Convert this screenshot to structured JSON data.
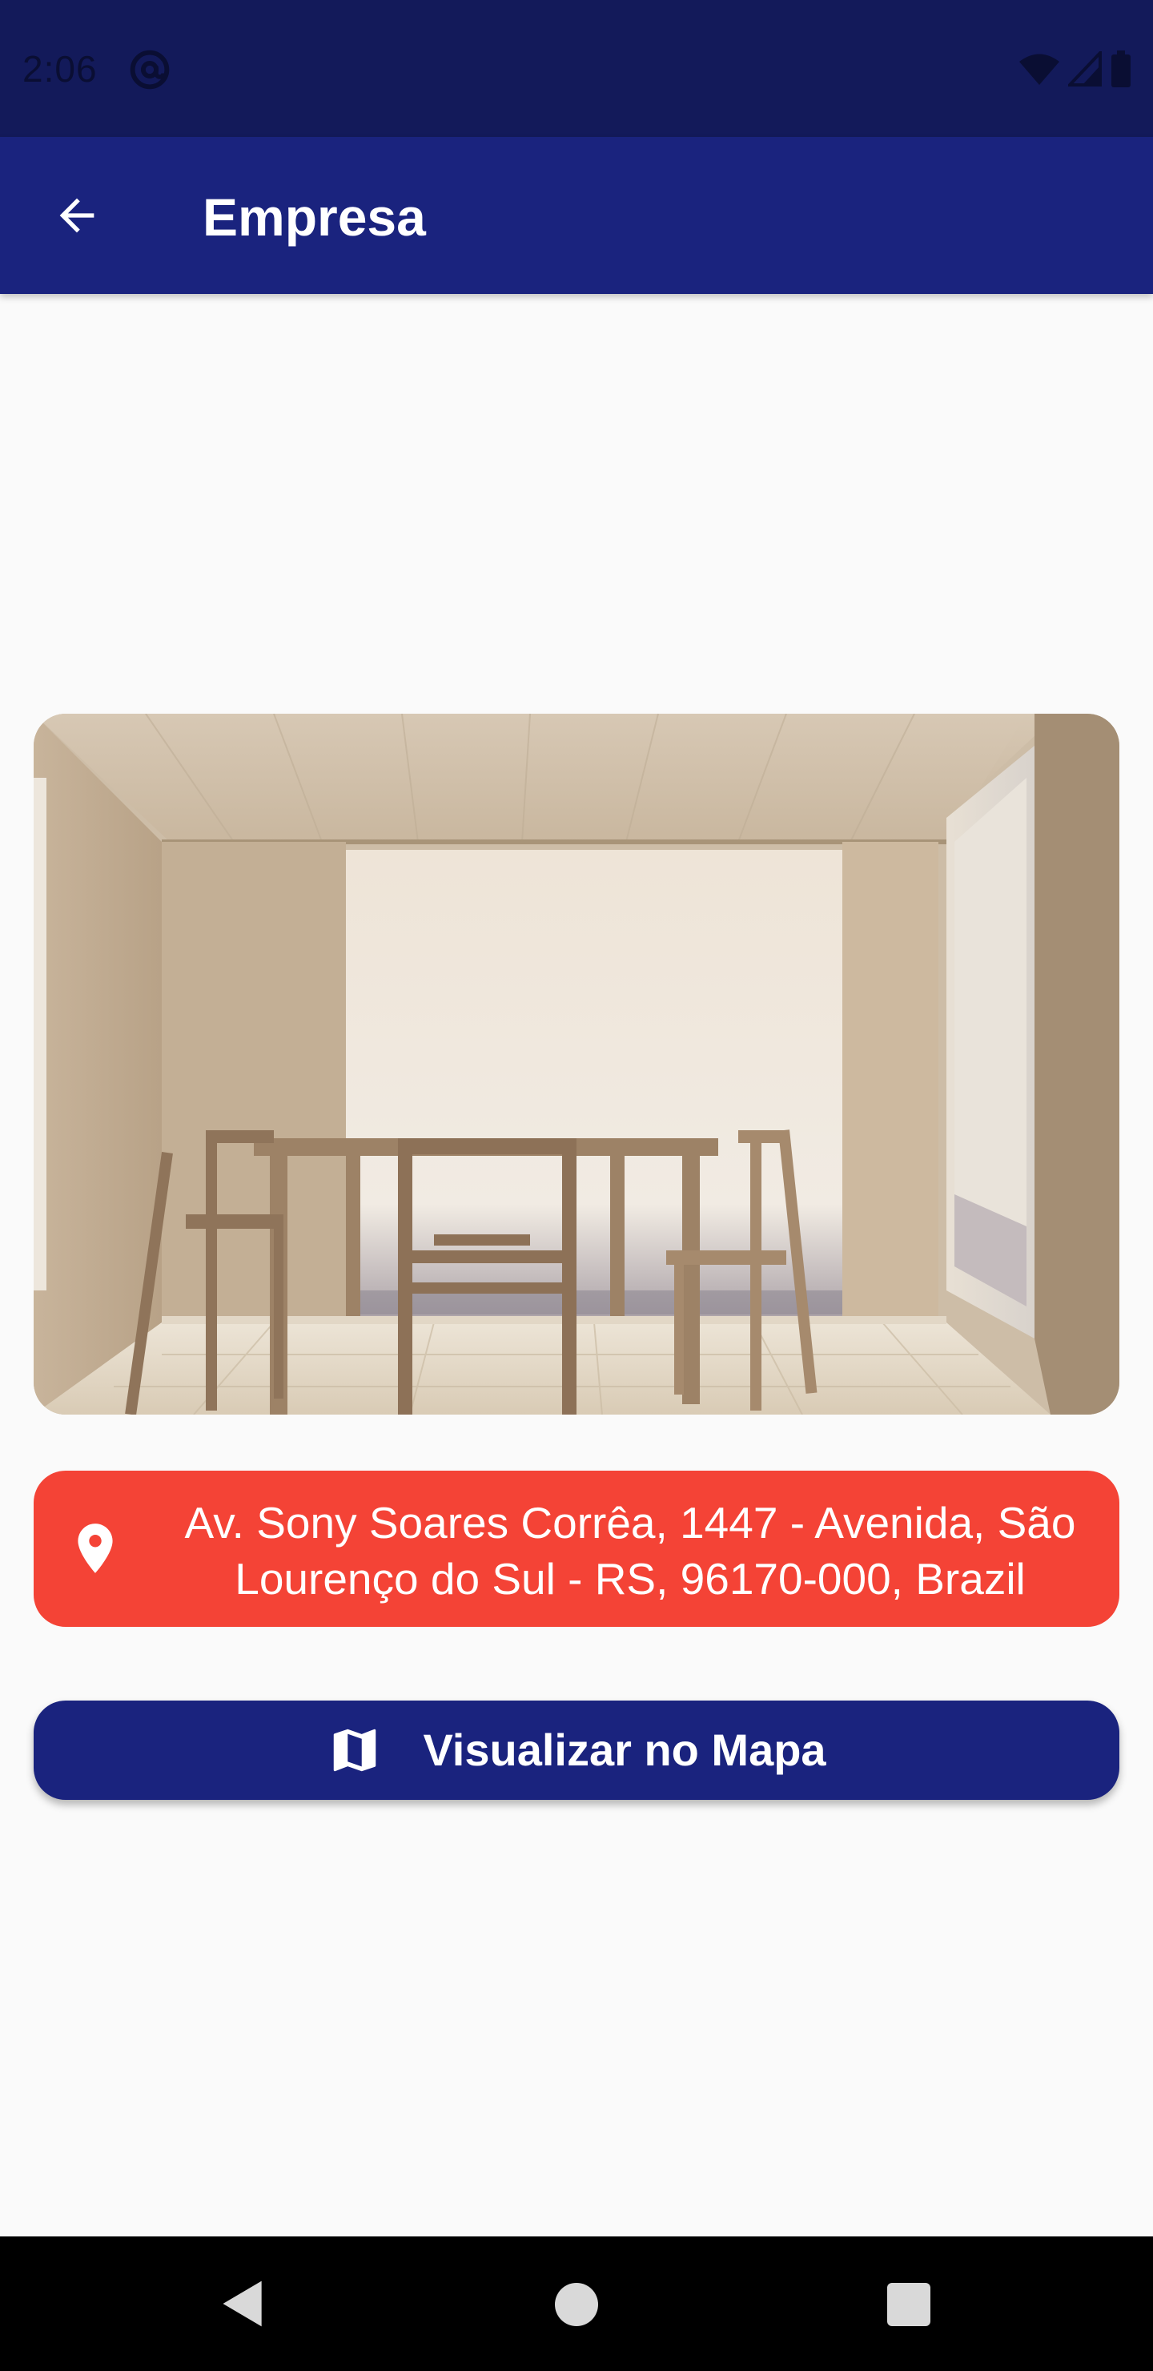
{
  "status_bar": {
    "time": "2:06",
    "icons": [
      "at-sign-icon",
      "wifi-icon",
      "cellular-signal-icon",
      "battery-icon"
    ]
  },
  "app_bar": {
    "back_icon": "arrow-back-icon",
    "title": "Empresa"
  },
  "photo": {
    "description_icon": "room-photo"
  },
  "address": {
    "icon": "location-pin-icon",
    "line1": "Av. Sony Soares Corrêa, 1447 - Avenida, São",
    "line2": "Lourenço do Sul - RS, 96170-000, Brazil"
  },
  "map_button": {
    "icon": "map-icon",
    "label": "Visualizar no Mapa"
  },
  "nav_bar": {
    "icons": [
      "nav-back-icon",
      "nav-home-icon",
      "nav-recents-icon"
    ]
  },
  "colors": {
    "status_bar": "#131a5a",
    "app_bar": "#1a237e",
    "address_card": "#f44336",
    "background": "#fafafa",
    "button": "#1a237e"
  }
}
